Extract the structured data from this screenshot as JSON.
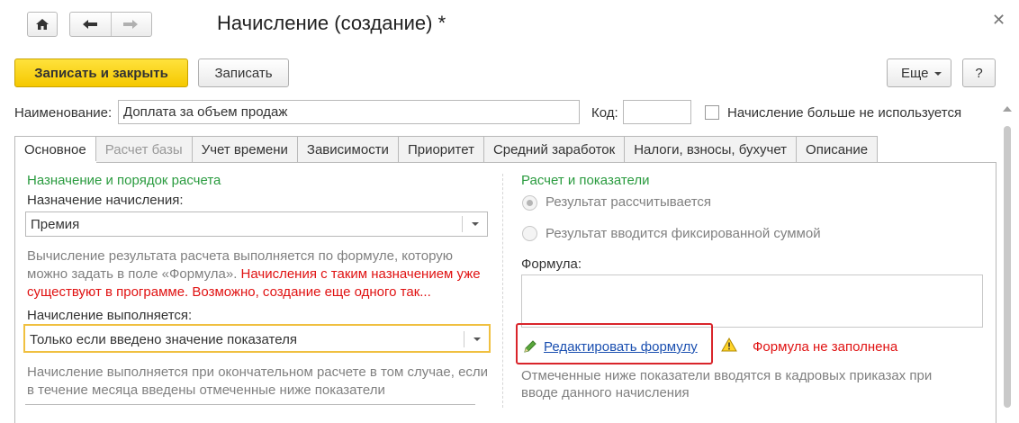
{
  "window": {
    "title": "Начисление (создание) *"
  },
  "toolbar": {
    "save_close_label": "Записать и закрыть",
    "save_label": "Записать",
    "more_label": "Еще",
    "help_label": "?"
  },
  "header_fields": {
    "name_label": "Наименование:",
    "name_value": "Доплата за объем продаж",
    "code_label": "Код:",
    "code_value": "",
    "unused_label": "Начисление больше не используется",
    "unused_checked": false
  },
  "tabs": [
    {
      "label": "Основное",
      "state": "active"
    },
    {
      "label": "Расчет базы",
      "state": "disabled"
    },
    {
      "label": "Учет времени",
      "state": "normal"
    },
    {
      "label": "Зависимости",
      "state": "normal"
    },
    {
      "label": "Приоритет",
      "state": "normal"
    },
    {
      "label": "Средний заработок",
      "state": "normal"
    },
    {
      "label": "Налоги, взносы, бухучет",
      "state": "normal"
    },
    {
      "label": "Описание",
      "state": "normal"
    }
  ],
  "left": {
    "section_title": "Назначение и порядок расчета",
    "purpose_label": "Назначение начисления:",
    "purpose_value": "Премия",
    "info_gray": "Вычисление результата расчета выполняется по формуле, которую можно задать в поле «Формула».",
    "info_red": "Начисления с таким назначением уже существуют в программе. Возможно, создание еще одного так...",
    "performed_label": "Начисление выполняется:",
    "performed_value": "Только если введено значение показателя",
    "performed_note": "Начисление выполняется при окончательном расчете в том случае, если в течение месяца введены отмеченные ниже показатели"
  },
  "right": {
    "section_title": "Расчет и показатели",
    "radio_calculated": "Результат рассчитывается",
    "radio_fixed": "Результат вводится фиксированной суммой",
    "formula_label": "Формула:",
    "formula_value": "",
    "edit_formula_link": "Редактировать формулу",
    "formula_warning": "Формула не заполнена",
    "indicators_note": "Отмеченные ниже показатели вводятся в кадровых приказах при вводе данного начисления"
  },
  "colors": {
    "section_green": "#2a9b3f",
    "error_red": "#e01212",
    "primary_yellow": "#f5c800",
    "link_blue": "#1a4fb0",
    "highlight_red": "#d9252b"
  }
}
